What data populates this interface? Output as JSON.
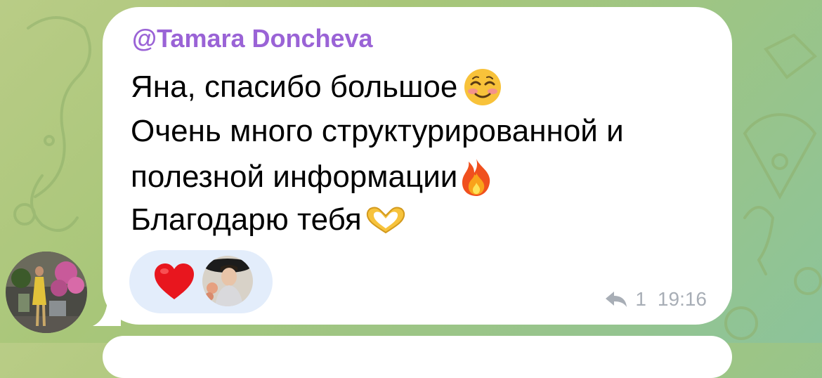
{
  "message": {
    "sender": "@Tamara Doncheva",
    "lines": [
      "Яна, спасибо большое",
      "Очень много структурированной и",
      "полезной информации",
      "Благодарю тебя"
    ],
    "line_emojis": [
      "smiling-face-icon",
      "",
      "fire-icon",
      "heart-hands-icon"
    ],
    "reactions": [
      {
        "icon": "red-heart-icon",
        "reactor": "reactor-avatar"
      }
    ],
    "reply_count": "1",
    "time": "19:16"
  },
  "colors": {
    "sender": "#9a63d6",
    "bubble": "#ffffff",
    "reaction_pill": "#e3edfb",
    "meta": "#a8aeb6",
    "wallpaper_start": "#b9cc86",
    "wallpaper_end": "#8cc39a"
  }
}
